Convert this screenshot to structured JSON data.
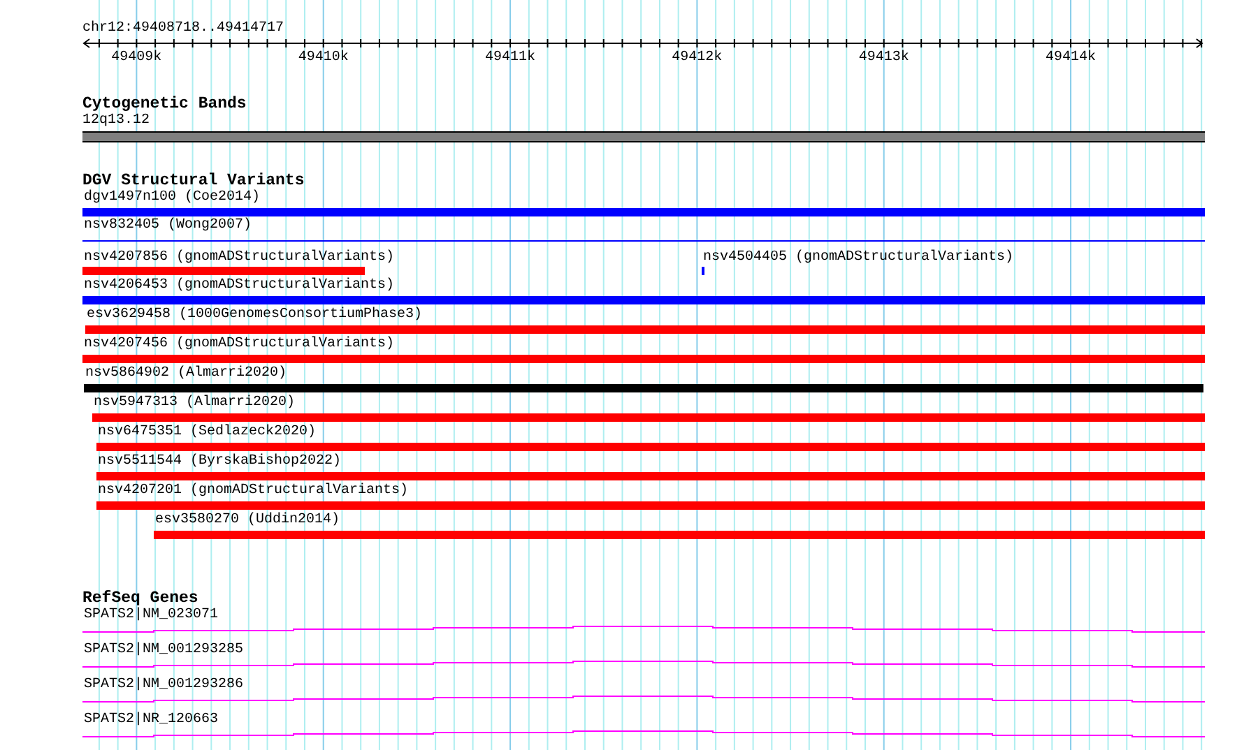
{
  "ruler": {
    "location": "chr12:49408718..49414717",
    "ticks": [
      "49409k",
      "49410k",
      "49411k",
      "49412k",
      "49413k",
      "49414k"
    ]
  },
  "tracks": [
    {
      "kind": "bands",
      "title": "Cytogenetic Bands",
      "features": [
        {
          "label": "12q13.12"
        }
      ]
    },
    {
      "kind": "variants",
      "title": "DGV Structural Variants",
      "rows": [
        {
          "features": [
            {
              "label": "dgv1497n100 (Coe2014)",
              "kind": "bar",
              "color": "#0000ff"
            }
          ]
        },
        {
          "features": [
            {
              "label": "nsv832405 (Wong2007)",
              "kind": "line",
              "color": "#0000ff"
            }
          ]
        },
        {
          "features": [
            {
              "label": "nsv4207856 (gnomADStructuralVariants)",
              "kind": "bar",
              "color": "#ff0000"
            },
            {
              "label": "nsv4504405 (gnomADStructuralVariants)",
              "kind": "bar",
              "color": "#0000ff"
            }
          ]
        },
        {
          "features": [
            {
              "label": "nsv4206453 (gnomADStructuralVariants)",
              "kind": "bar",
              "color": "#0000ff"
            }
          ]
        },
        {
          "features": [
            {
              "label": "esv3629458 (1000GenomesConsortiumPhase3)",
              "kind": "bar",
              "color": "#ff0000"
            }
          ]
        },
        {
          "features": [
            {
              "label": "nsv4207456 (gnomADStructuralVariants)",
              "kind": "bar",
              "color": "#ff0000"
            }
          ]
        },
        {
          "features": [
            {
              "label": "nsv5864902 (Almarri2020)",
              "kind": "bar",
              "color": "#000000"
            }
          ]
        },
        {
          "features": [
            {
              "label": "nsv5947313 (Almarri2020)",
              "kind": "bar",
              "color": "#ff0000"
            }
          ]
        },
        {
          "features": [
            {
              "label": "nsv6475351 (Sedlazeck2020)",
              "kind": "bar",
              "color": "#ff0000"
            }
          ]
        },
        {
          "features": [
            {
              "label": "nsv5511544 (ByrskaBishop2022)",
              "kind": "bar",
              "color": "#ff0000"
            }
          ]
        },
        {
          "features": [
            {
              "label": "nsv4207201 (gnomADStructuralVariants)",
              "kind": "bar",
              "color": "#ff0000"
            }
          ]
        },
        {
          "features": [
            {
              "label": "esv3580270 (Uddin2014)",
              "kind": "bar",
              "color": "#ff0000"
            }
          ]
        }
      ]
    },
    {
      "kind": "genes",
      "title": "RefSeq Genes",
      "features": [
        {
          "label": "SPATS2|NM_023071"
        },
        {
          "label": "SPATS2|NM_001293285"
        },
        {
          "label": "SPATS2|NM_001293286"
        },
        {
          "label": "SPATS2|NR_120663"
        }
      ]
    }
  ]
}
